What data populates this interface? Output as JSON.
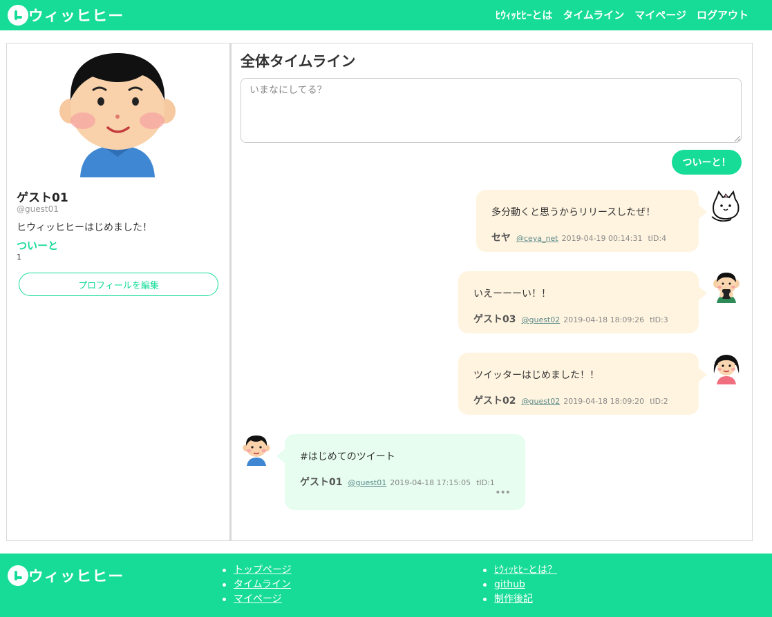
{
  "brand": {
    "logo_text": "ウィッヒヒー",
    "accent_color": "#16dc98",
    "bubble_other_color": "#fff4e0",
    "bubble_mine_color": "#e6fdef"
  },
  "header": {
    "nav": [
      {
        "label": "ﾋｳｨｯﾋﾋｰとは"
      },
      {
        "label": "タイムライン"
      },
      {
        "label": "マイページ"
      },
      {
        "label": "ログアウト"
      }
    ]
  },
  "profile": {
    "avatar_icon": "boy-avatar-icon",
    "name": "ゲスト01",
    "handle": "@guest01",
    "bio": "ヒウィッヒヒーはじめました！",
    "tweet_label": "ついーと",
    "tweet_count": "1",
    "edit_button": "プロフィールを編集"
  },
  "timeline": {
    "title": "全体タイムライン",
    "input_placeholder": "いまなにしてる？",
    "post_button": "ついーと！",
    "tweets": [
      {
        "text": "多分動くと思うからリリースしたぜ！",
        "author": "セヤ",
        "handle": "@ceya_net",
        "date": "2019-04-19 00:14:31",
        "tid": "tID:4",
        "avatar": "cat-doodle-icon",
        "mine": false
      },
      {
        "text": "いえーーーい！！",
        "author": "ゲスト03",
        "handle": "@guest02",
        "date": "2019-04-18 18:09:26",
        "tid": "tID:3",
        "avatar": "girl-smartphone-avatar-icon",
        "mine": false
      },
      {
        "text": "ツイッターはじめました！！",
        "author": "ゲスト02",
        "handle": "@guest02",
        "date": "2019-04-18 18:09:20",
        "tid": "tID:2",
        "avatar": "girl-avatar-icon",
        "mine": false
      },
      {
        "text": "#はじめてのツイート",
        "author": "ゲスト01",
        "handle": "@guest01",
        "date": "2019-04-18 17:15:05",
        "tid": "tID:1",
        "avatar": "boy-avatar-icon",
        "mine": true,
        "more": "•••"
      }
    ]
  },
  "footer": {
    "links_col1": [
      {
        "label": "トップページ"
      },
      {
        "label": "タイムライン"
      },
      {
        "label": "マイページ"
      }
    ],
    "links_col2": [
      {
        "label": "ﾋｳｨｯﾋﾋｰとは？"
      },
      {
        "label": "github"
      },
      {
        "label": "制作後記"
      }
    ]
  }
}
